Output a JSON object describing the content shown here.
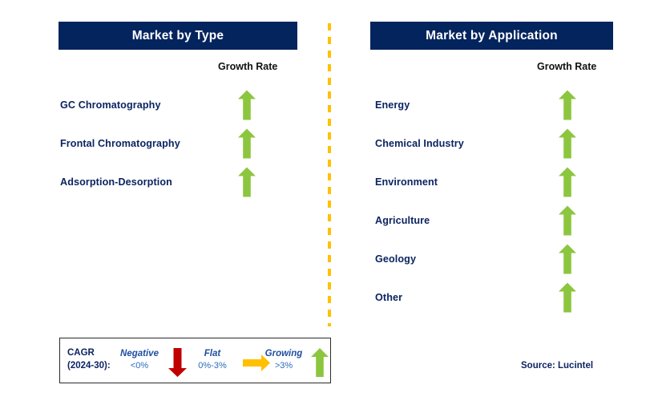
{
  "panels": [
    {
      "id": "type",
      "title": "Market by Type",
      "column_header": "Growth Rate",
      "items": [
        {
          "label": "GC Chromatography",
          "growth": "growing",
          "arrow_icon": "arrow-up-icon"
        },
        {
          "label": "Frontal Chromatography",
          "growth": "growing",
          "arrow_icon": "arrow-up-icon"
        },
        {
          "label": "Adsorption-Desorption",
          "growth": "growing",
          "arrow_icon": "arrow-up-icon"
        }
      ]
    },
    {
      "id": "application",
      "title": "Market by Application",
      "column_header": "Growth Rate",
      "items": [
        {
          "label": "Energy",
          "growth": "growing",
          "arrow_icon": "arrow-up-icon"
        },
        {
          "label": "Chemical Industry",
          "growth": "growing",
          "arrow_icon": "arrow-up-icon"
        },
        {
          "label": "Environment",
          "growth": "growing",
          "arrow_icon": "arrow-up-icon"
        },
        {
          "label": "Agriculture",
          "growth": "growing",
          "arrow_icon": "arrow-up-icon"
        },
        {
          "label": "Geology",
          "growth": "growing",
          "arrow_icon": "arrow-up-icon"
        },
        {
          "label": "Other",
          "growth": "growing",
          "arrow_icon": "arrow-up-icon"
        }
      ]
    }
  ],
  "legend": {
    "cagr_line1": "CAGR",
    "cagr_line2": "(2024-30):",
    "entries": [
      {
        "title": "Negative",
        "value": "<0%",
        "arrow_icon": "arrow-down-icon",
        "color": "#c00000"
      },
      {
        "title": "Flat",
        "value": "0%-3%",
        "arrow_icon": "arrow-right-icon",
        "color": "#ffc000"
      },
      {
        "title": "Growing",
        "value": ">3%",
        "arrow_icon": "arrow-up-icon",
        "color": "#8cc63f"
      }
    ]
  },
  "source": "Source: Lucintel",
  "colors": {
    "header_bar": "#04245e",
    "label_navy": "#0c2461",
    "growing_green": "#8cc63f",
    "negative_red": "#c00000",
    "flat_orange": "#ffc000",
    "divider_orange": "#ffc000"
  }
}
